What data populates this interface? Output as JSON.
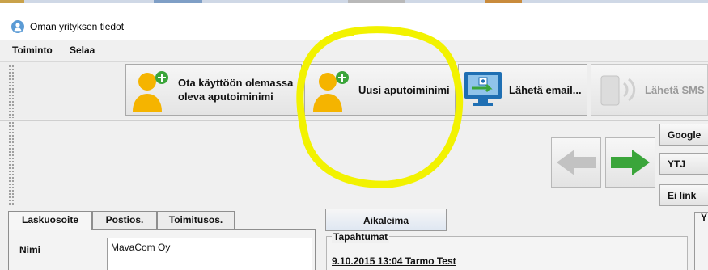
{
  "window": {
    "title": "Oman yrityksen tiedot"
  },
  "menubar": {
    "items": [
      "Toiminto",
      "Selaa"
    ]
  },
  "toolbar": {
    "buttons": [
      {
        "label_line1": "Ota käyttöön olemassa",
        "label_line2": "oleva aputoiminimi",
        "icon": "person-add-icon"
      },
      {
        "label": "Uusi aputoiminimi",
        "icon": "person-add-icon"
      },
      {
        "label": "Lähetä email...",
        "icon": "monitor-email-icon"
      },
      {
        "label": "Lähetä SMS",
        "icon": "phone-signal-icon",
        "disabled": true
      }
    ]
  },
  "nav": {
    "back_icon": "arrow-left-icon",
    "forward_icon": "arrow-right-icon",
    "side_buttons": [
      "Google",
      "YTJ",
      "Ei link"
    ]
  },
  "tabs": [
    "Laskuosoite",
    "Postios.",
    "Toimitusos."
  ],
  "form": {
    "name_label": "Nimi",
    "name_value": "MavaCom Oy"
  },
  "events": {
    "timestamp_button": "Aikaleima",
    "group_title": "Tapahtumat",
    "entries": [
      "9.10.2015 13:04 Tarmo Test"
    ]
  },
  "right_tab": "Y",
  "colors": {
    "highlight": "#f2f200",
    "person_icon": "#f5b400",
    "plus_badge": "#3aa53a",
    "arrow_forward": "#3aa53a",
    "arrow_back": "#c2c2c2"
  }
}
